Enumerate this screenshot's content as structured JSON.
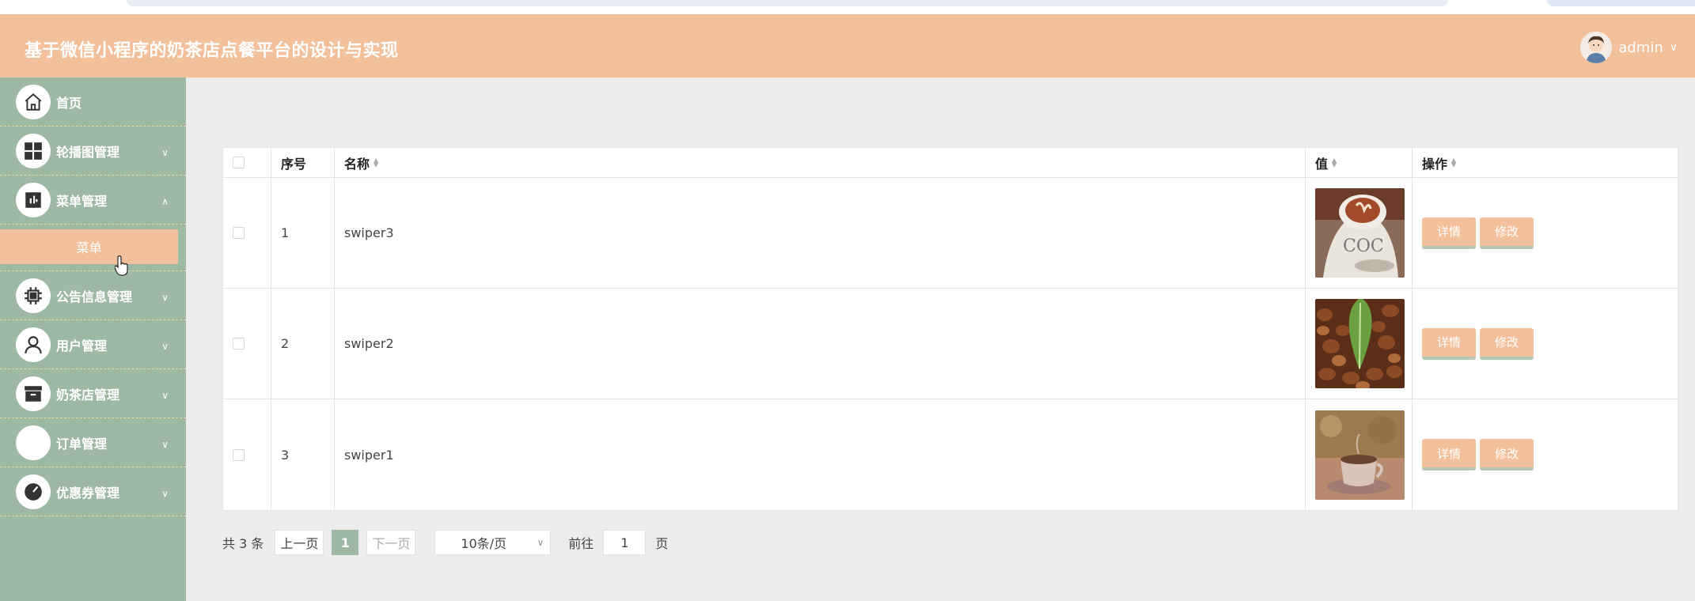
{
  "header": {
    "title": "基于微信小程序的奶茶店点餐平台的设计与实现",
    "username": "admin",
    "user_chevron_icon": "chevron-down-icon"
  },
  "sidebar": {
    "items": [
      {
        "label": "首页",
        "icon": "home-icon",
        "arrow": ""
      },
      {
        "label": "轮播图管理",
        "icon": "grid-icon",
        "arrow": "∨"
      },
      {
        "label": "菜单管理",
        "icon": "chart-icon",
        "arrow": "∧"
      },
      {
        "label": "公告信息管理",
        "icon": "chip-icon",
        "arrow": "∨"
      },
      {
        "label": "用户管理",
        "icon": "user-icon",
        "arrow": "∨"
      },
      {
        "label": "奶茶店管理",
        "icon": "box-icon",
        "arrow": "∨"
      },
      {
        "label": "订单管理",
        "icon": "order-icon",
        "arrow": "∨"
      },
      {
        "label": "优惠券管理",
        "icon": "gauge-icon",
        "arrow": "∨"
      }
    ],
    "active_sub": "菜单"
  },
  "table": {
    "headers": {
      "index": "序号",
      "name": "名称",
      "value": "值",
      "actions": "操作"
    },
    "rows": [
      {
        "index": "1",
        "name": "swiper3",
        "thumb": "coffee-latte-image"
      },
      {
        "index": "2",
        "name": "swiper2",
        "thumb": "coffee-beans-image"
      },
      {
        "index": "3",
        "name": "swiper1",
        "thumb": "coffee-cup-image"
      }
    ],
    "detail_label": "详情",
    "edit_label": "修改"
  },
  "pager": {
    "total": "共 3 条",
    "prev": "上一页",
    "current": "1",
    "next": "下一页",
    "page_size": "10条/页",
    "goto": "前往",
    "goto_value": "1",
    "page_unit": "页"
  },
  "colors": {
    "accent": "#f3c09c",
    "sidebar": "#9eb9a3",
    "background": "#ececec"
  }
}
